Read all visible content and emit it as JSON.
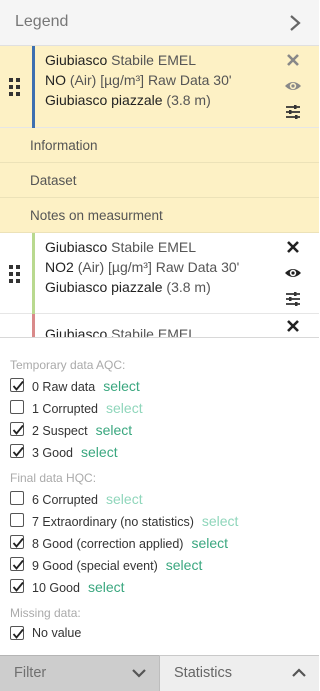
{
  "legend": {
    "title": "Legend"
  },
  "layers": [
    {
      "station_bold": "Giubiasco",
      "station_rest": "Stabile EMEL",
      "param_bold": "NO",
      "param_rest": "(Air) [µg/m³] Raw Data 30'",
      "site_bold": "Giubiasco piazzale",
      "site_rest": "(3.8 m)",
      "color": "#3d6fb0",
      "active": true,
      "subitems": [
        "Information",
        "Dataset",
        "Notes on measurment"
      ]
    },
    {
      "station_bold": "Giubiasco",
      "station_rest": "Stabile EMEL",
      "param_bold": "NO2",
      "param_rest": "(Air) [µg/m³] Raw Data 30'",
      "site_bold": "Giubiasco piazzale",
      "site_rest": "(3.8 m)",
      "color": "#b9d98f"
    },
    {
      "station_bold": "Giubiasco",
      "station_rest": "Stabile EMEL",
      "color": "#d98a8a"
    }
  ],
  "filters": {
    "temporary_title": "Temporary data AQC:",
    "temporary": [
      {
        "label": "0 Raw data",
        "checked": true,
        "select": "select",
        "enabled": true
      },
      {
        "label": "1 Corrupted",
        "checked": false,
        "select": "select",
        "enabled": false
      },
      {
        "label": "2 Suspect",
        "checked": true,
        "select": "select",
        "enabled": true
      },
      {
        "label": "3 Good",
        "checked": true,
        "select": "select",
        "enabled": true
      }
    ],
    "final_title": "Final data HQC:",
    "final": [
      {
        "label": "6 Corrupted",
        "checked": false,
        "select": "select",
        "enabled": false
      },
      {
        "label": "7 Extraordinary (no statistics)",
        "checked": false,
        "select": "select",
        "enabled": false
      },
      {
        "label": "8 Good (correction applied)",
        "checked": true,
        "select": "select",
        "enabled": true
      },
      {
        "label": "9 Good (special event)",
        "checked": true,
        "select": "select",
        "enabled": true
      },
      {
        "label": "10 Good",
        "checked": true,
        "select": "select",
        "enabled": true
      }
    ],
    "missing_title": "Missing data:",
    "missing": [
      {
        "label": "No value",
        "checked": true
      }
    ]
  },
  "bottom_tabs": {
    "filter": "Filter",
    "statistics": "Statistics"
  }
}
